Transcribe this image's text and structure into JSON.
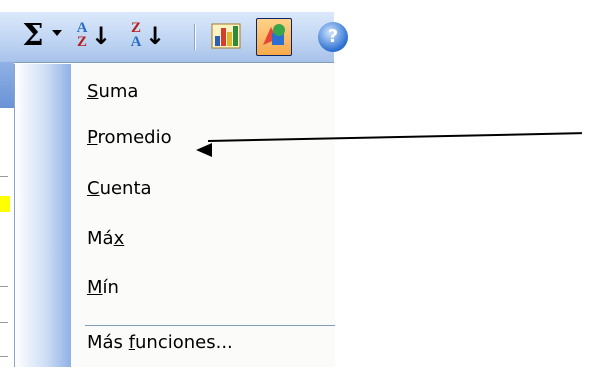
{
  "toolbar": {
    "autosum_symbol": "Σ",
    "sort_asc_letters": [
      "A",
      "Z"
    ],
    "sort_desc_letters": [
      "Z",
      "A"
    ],
    "sort_arrow": "↓",
    "help_symbol": "?"
  },
  "menu": {
    "items": [
      {
        "label": "Suma",
        "mnemonic": "S"
      },
      {
        "label": "Promedio",
        "mnemonic": "P"
      },
      {
        "label": "Cuenta",
        "mnemonic": "C"
      },
      {
        "label": "Máx",
        "mnemonic": "x"
      },
      {
        "label": "Mín",
        "mnemonic": "M"
      },
      {
        "label": "Más funciones...",
        "mnemonic": "f"
      }
    ]
  },
  "annotation": {
    "points_to": "Promedio"
  }
}
